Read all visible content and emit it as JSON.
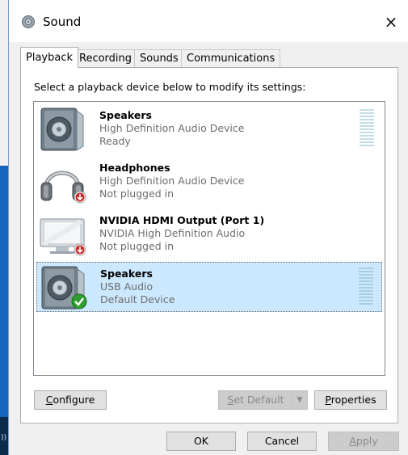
{
  "window": {
    "title": "Sound",
    "icon": "speaker-icon",
    "close_label": "×"
  },
  "tabs": [
    {
      "label": "Playback",
      "active": true
    },
    {
      "label": "Recording",
      "active": false
    },
    {
      "label": "Sounds",
      "active": false
    },
    {
      "label": "Communications",
      "active": false
    }
  ],
  "panel": {
    "instructions": "Select a playback device below to modify its settings:"
  },
  "devices": [
    {
      "name": "Speakers",
      "driver": "High Definition Audio Device",
      "status": "Ready",
      "icon": "speaker-icon",
      "badge": "none",
      "selected": false
    },
    {
      "name": "Headphones",
      "driver": "High Definition Audio Device",
      "status": "Not plugged in",
      "icon": "headphones-icon",
      "badge": "unplugged-arrow-icon",
      "selected": false
    },
    {
      "name": "NVIDIA HDMI Output (Port 1)",
      "driver": "NVIDIA High Definition Audio",
      "status": "Not plugged in",
      "icon": "monitor-icon",
      "badge": "unplugged-arrow-icon",
      "selected": false
    },
    {
      "name": "Speakers",
      "driver": "USB Audio",
      "status": "Default Device",
      "icon": "speaker-icon",
      "badge": "default-check-icon",
      "selected": true
    }
  ],
  "buttons": {
    "configure": {
      "label": "Configure",
      "mnemonic": "C"
    },
    "set_default": {
      "label": "Set Default",
      "mnemonic": "S",
      "disabled": true
    },
    "properties": {
      "label": "Properties",
      "mnemonic": "P"
    },
    "ok": {
      "label": "OK"
    },
    "cancel": {
      "label": "Cancel"
    },
    "apply": {
      "label": "Apply",
      "mnemonic": "A",
      "disabled": true
    }
  },
  "taskbar_glyph": "))",
  "colors": {
    "selection": "#cce8ff",
    "desktop": "#1565c0",
    "check": "#2e9e2e",
    "unplugged": "#c62828"
  }
}
